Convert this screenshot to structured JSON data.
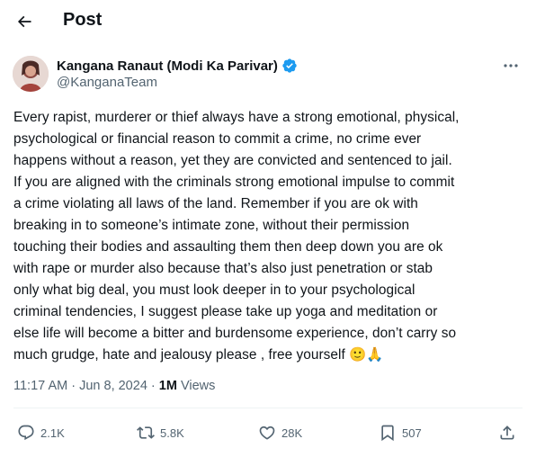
{
  "header": {
    "title": "Post",
    "back_icon": "arrow-left-icon"
  },
  "author": {
    "name": "Kangana Ranaut (Modi Ka Parivar)",
    "handle": "@KanganaTeam",
    "verified_color": "#1d9bf0"
  },
  "tweet": {
    "text": "Every rapist, murderer or thief always have a strong emotional, physical,\npsychological or financial reason to commit a crime, no crime ever\nhappens without a reason, yet they are convicted and sentenced to jail.\nIf you are aligned with the criminals strong emotional impulse to commit\na crime violating all laws of the land. Remember if you are ok with\nbreaking in to someone’s intimate zone, without their permission\ntouching their bodies and assaulting them then deep down you are ok\nwith rape or murder also because that’s also just penetration or stab\nonly what big deal, you must look deeper in to your psychological\ncriminal tendencies, I suggest please take up yoga and meditation or\nelse life will become a bitter and burdensome experience, don’t carry so\nmuch grudge, hate and jealousy please , free yourself 🙂🙏"
  },
  "meta": {
    "time": "11:17 AM",
    "separator": " · ",
    "date": "Jun 8, 2024",
    "separator2": " · ",
    "views_count": "1M",
    "views_label": " Views"
  },
  "actions": {
    "replies": "2.1K",
    "reposts": "5.8K",
    "likes": "28K",
    "bookmarks": "507"
  }
}
